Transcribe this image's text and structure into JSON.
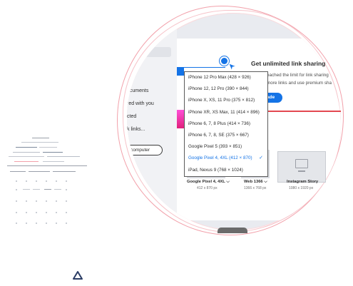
{
  "sidebar": {
    "items": [
      "ocuments",
      "red with you",
      "cted",
      "k links..."
    ],
    "button_label": "r computer"
  },
  "dropdown": {
    "items": [
      "iPhone 12 Pro Max (428 × 926)",
      "iPhone 12, 12 Pro (390 × 844)",
      "iPhone X, XS, 11 Pro (375 × 812)",
      "iPhone XR, XS Max, 11 (414 × 896)",
      "iPhone 6, 7, 8 Plus (414 × 736)",
      "iPhone 6, 7, 8, SE (375 × 667)",
      "Google Pixel 5 (393 × 851)",
      "Google Pixel 4, 4XL (412 × 870)",
      "iPad, Nexus 9 (768 × 1024)"
    ],
    "selected": "Google Pixel 4, 4XL (412 × 870)",
    "check_icon": "checkmark-icon"
  },
  "promo": {
    "title": "Get unlimited link sharing",
    "line1": "eached the limit for link sharing",
    "line2": "more links and use premium sha",
    "button_label": "ade"
  },
  "sizes": [
    {
      "name": "Google Pixel 4, 4XL",
      "dims": "412 x 870 px",
      "chevron": "chevron-down-icon"
    },
    {
      "name": "Web 1366",
      "dims": "1366 x 768 px",
      "chevron": "chevron-down-icon"
    },
    {
      "name": "Instagram Story",
      "dims": "1080 x 1920 px",
      "chevron": ""
    }
  ],
  "colors": {
    "accent": "#1473e6",
    "highlight": "#e34850",
    "pink": "#ff4fd8"
  },
  "icons": {
    "cursor": "pointer-cursor-icon",
    "triangle": "triangle-outline-icon",
    "image": "image-placeholder-icon"
  }
}
